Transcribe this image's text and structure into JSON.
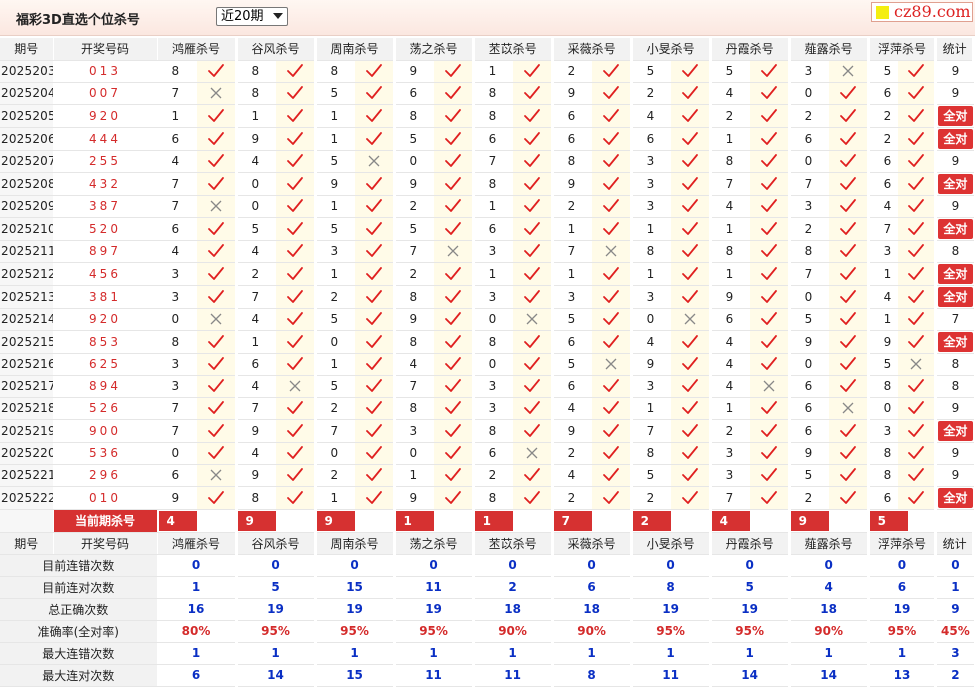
{
  "title": "福彩3D直选个位杀号",
  "period_select": {
    "selected": "近20期"
  },
  "logo": {
    "text": "cz89.com"
  },
  "colors": {
    "accent": "#d63131",
    "blue": "#0a2fc4",
    "mark_bg": "#fffbe8"
  },
  "icons": {
    "correct": "check-icon",
    "wrong": "cross-icon"
  },
  "headers": [
    "期号",
    "开奖号码",
    "鸿雁杀号",
    "谷风杀号",
    "周南杀号",
    "荡之杀号",
    "苤苡杀号",
    "采薇杀号",
    "小旻杀号",
    "丹霞杀号",
    "薤露杀号",
    "浮萍杀号",
    "统计"
  ],
  "rows": [
    {
      "period": "2025203",
      "number": "013",
      "kills": [
        [
          "8",
          "ok"
        ],
        [
          "8",
          "ok"
        ],
        [
          "8",
          "ok"
        ],
        [
          "9",
          "ok"
        ],
        [
          "1",
          "ok"
        ],
        [
          "2",
          "ok"
        ],
        [
          "5",
          "ok"
        ],
        [
          "5",
          "ok"
        ],
        [
          "3",
          "x"
        ],
        [
          "5",
          "ok"
        ]
      ],
      "stat": "9"
    },
    {
      "period": "2025204",
      "number": "007",
      "kills": [
        [
          "7",
          "x"
        ],
        [
          "8",
          "ok"
        ],
        [
          "5",
          "ok"
        ],
        [
          "6",
          "ok"
        ],
        [
          "8",
          "ok"
        ],
        [
          "9",
          "ok"
        ],
        [
          "2",
          "ok"
        ],
        [
          "4",
          "ok"
        ],
        [
          "0",
          "ok"
        ],
        [
          "6",
          "ok"
        ]
      ],
      "stat": "9"
    },
    {
      "period": "2025205",
      "number": "920",
      "kills": [
        [
          "1",
          "ok"
        ],
        [
          "1",
          "ok"
        ],
        [
          "1",
          "ok"
        ],
        [
          "8",
          "ok"
        ],
        [
          "8",
          "ok"
        ],
        [
          "6",
          "ok"
        ],
        [
          "4",
          "ok"
        ],
        [
          "2",
          "ok"
        ],
        [
          "2",
          "ok"
        ],
        [
          "2",
          "ok"
        ]
      ],
      "stat": "全对"
    },
    {
      "period": "2025206",
      "number": "444",
      "kills": [
        [
          "6",
          "ok"
        ],
        [
          "9",
          "ok"
        ],
        [
          "1",
          "ok"
        ],
        [
          "5",
          "ok"
        ],
        [
          "6",
          "ok"
        ],
        [
          "6",
          "ok"
        ],
        [
          "6",
          "ok"
        ],
        [
          "1",
          "ok"
        ],
        [
          "6",
          "ok"
        ],
        [
          "2",
          "ok"
        ]
      ],
      "stat": "全对"
    },
    {
      "period": "2025207",
      "number": "255",
      "kills": [
        [
          "4",
          "ok"
        ],
        [
          "4",
          "ok"
        ],
        [
          "5",
          "x"
        ],
        [
          "0",
          "ok"
        ],
        [
          "7",
          "ok"
        ],
        [
          "8",
          "ok"
        ],
        [
          "3",
          "ok"
        ],
        [
          "8",
          "ok"
        ],
        [
          "0",
          "ok"
        ],
        [
          "6",
          "ok"
        ]
      ],
      "stat": "9"
    },
    {
      "period": "2025208",
      "number": "432",
      "kills": [
        [
          "7",
          "ok"
        ],
        [
          "0",
          "ok"
        ],
        [
          "9",
          "ok"
        ],
        [
          "9",
          "ok"
        ],
        [
          "8",
          "ok"
        ],
        [
          "9",
          "ok"
        ],
        [
          "3",
          "ok"
        ],
        [
          "7",
          "ok"
        ],
        [
          "7",
          "ok"
        ],
        [
          "6",
          "ok"
        ]
      ],
      "stat": "全对"
    },
    {
      "period": "2025209",
      "number": "387",
      "kills": [
        [
          "7",
          "x"
        ],
        [
          "0",
          "ok"
        ],
        [
          "1",
          "ok"
        ],
        [
          "2",
          "ok"
        ],
        [
          "1",
          "ok"
        ],
        [
          "2",
          "ok"
        ],
        [
          "3",
          "ok"
        ],
        [
          "4",
          "ok"
        ],
        [
          "3",
          "ok"
        ],
        [
          "4",
          "ok"
        ]
      ],
      "stat": "9"
    },
    {
      "period": "2025210",
      "number": "520",
      "kills": [
        [
          "6",
          "ok"
        ],
        [
          "5",
          "ok"
        ],
        [
          "5",
          "ok"
        ],
        [
          "5",
          "ok"
        ],
        [
          "6",
          "ok"
        ],
        [
          "1",
          "ok"
        ],
        [
          "1",
          "ok"
        ],
        [
          "1",
          "ok"
        ],
        [
          "2",
          "ok"
        ],
        [
          "7",
          "ok"
        ]
      ],
      "stat": "全对"
    },
    {
      "period": "2025211",
      "number": "897",
      "kills": [
        [
          "4",
          "ok"
        ],
        [
          "4",
          "ok"
        ],
        [
          "3",
          "ok"
        ],
        [
          "7",
          "x"
        ],
        [
          "3",
          "ok"
        ],
        [
          "7",
          "x"
        ],
        [
          "8",
          "ok"
        ],
        [
          "8",
          "ok"
        ],
        [
          "8",
          "ok"
        ],
        [
          "3",
          "ok"
        ]
      ],
      "stat": "8"
    },
    {
      "period": "2025212",
      "number": "456",
      "kills": [
        [
          "3",
          "ok"
        ],
        [
          "2",
          "ok"
        ],
        [
          "1",
          "ok"
        ],
        [
          "2",
          "ok"
        ],
        [
          "1",
          "ok"
        ],
        [
          "1",
          "ok"
        ],
        [
          "1",
          "ok"
        ],
        [
          "1",
          "ok"
        ],
        [
          "7",
          "ok"
        ],
        [
          "1",
          "ok"
        ]
      ],
      "stat": "全对"
    },
    {
      "period": "2025213",
      "number": "381",
      "kills": [
        [
          "3",
          "ok"
        ],
        [
          "7",
          "ok"
        ],
        [
          "2",
          "ok"
        ],
        [
          "8",
          "ok"
        ],
        [
          "3",
          "ok"
        ],
        [
          "3",
          "ok"
        ],
        [
          "3",
          "ok"
        ],
        [
          "9",
          "ok"
        ],
        [
          "0",
          "ok"
        ],
        [
          "4",
          "ok"
        ]
      ],
      "stat": "全对"
    },
    {
      "period": "2025214",
      "number": "920",
      "kills": [
        [
          "0",
          "x"
        ],
        [
          "4",
          "ok"
        ],
        [
          "5",
          "ok"
        ],
        [
          "9",
          "ok"
        ],
        [
          "0",
          "x"
        ],
        [
          "5",
          "ok"
        ],
        [
          "0",
          "x"
        ],
        [
          "6",
          "ok"
        ],
        [
          "5",
          "ok"
        ],
        [
          "1",
          "ok"
        ]
      ],
      "stat": "7"
    },
    {
      "period": "2025215",
      "number": "853",
      "kills": [
        [
          "8",
          "ok"
        ],
        [
          "1",
          "ok"
        ],
        [
          "0",
          "ok"
        ],
        [
          "8",
          "ok"
        ],
        [
          "8",
          "ok"
        ],
        [
          "6",
          "ok"
        ],
        [
          "4",
          "ok"
        ],
        [
          "4",
          "ok"
        ],
        [
          "9",
          "ok"
        ],
        [
          "9",
          "ok"
        ]
      ],
      "stat": "全对"
    },
    {
      "period": "2025216",
      "number": "625",
      "kills": [
        [
          "3",
          "ok"
        ],
        [
          "6",
          "ok"
        ],
        [
          "1",
          "ok"
        ],
        [
          "4",
          "ok"
        ],
        [
          "0",
          "ok"
        ],
        [
          "5",
          "x"
        ],
        [
          "9",
          "ok"
        ],
        [
          "4",
          "ok"
        ],
        [
          "0",
          "ok"
        ],
        [
          "5",
          "x"
        ]
      ],
      "stat": "8"
    },
    {
      "period": "2025217",
      "number": "894",
      "kills": [
        [
          "3",
          "ok"
        ],
        [
          "4",
          "x"
        ],
        [
          "5",
          "ok"
        ],
        [
          "7",
          "ok"
        ],
        [
          "3",
          "ok"
        ],
        [
          "6",
          "ok"
        ],
        [
          "3",
          "ok"
        ],
        [
          "4",
          "x"
        ],
        [
          "6",
          "ok"
        ],
        [
          "8",
          "ok"
        ]
      ],
      "stat": "8"
    },
    {
      "period": "2025218",
      "number": "526",
      "kills": [
        [
          "7",
          "ok"
        ],
        [
          "7",
          "ok"
        ],
        [
          "2",
          "ok"
        ],
        [
          "8",
          "ok"
        ],
        [
          "3",
          "ok"
        ],
        [
          "4",
          "ok"
        ],
        [
          "1",
          "ok"
        ],
        [
          "1",
          "ok"
        ],
        [
          "6",
          "x"
        ],
        [
          "0",
          "ok"
        ]
      ],
      "stat": "9"
    },
    {
      "period": "2025219",
      "number": "900",
      "kills": [
        [
          "7",
          "ok"
        ],
        [
          "9",
          "ok"
        ],
        [
          "7",
          "ok"
        ],
        [
          "3",
          "ok"
        ],
        [
          "8",
          "ok"
        ],
        [
          "9",
          "ok"
        ],
        [
          "7",
          "ok"
        ],
        [
          "2",
          "ok"
        ],
        [
          "6",
          "ok"
        ],
        [
          "3",
          "ok"
        ]
      ],
      "stat": "全对"
    },
    {
      "period": "2025220",
      "number": "536",
      "kills": [
        [
          "0",
          "ok"
        ],
        [
          "4",
          "ok"
        ],
        [
          "0",
          "ok"
        ],
        [
          "0",
          "ok"
        ],
        [
          "6",
          "x"
        ],
        [
          "2",
          "ok"
        ],
        [
          "8",
          "ok"
        ],
        [
          "3",
          "ok"
        ],
        [
          "9",
          "ok"
        ],
        [
          "8",
          "ok"
        ]
      ],
      "stat": "9"
    },
    {
      "period": "2025221",
      "number": "296",
      "kills": [
        [
          "6",
          "x"
        ],
        [
          "9",
          "ok"
        ],
        [
          "2",
          "ok"
        ],
        [
          "1",
          "ok"
        ],
        [
          "2",
          "ok"
        ],
        [
          "4",
          "ok"
        ],
        [
          "5",
          "ok"
        ],
        [
          "3",
          "ok"
        ],
        [
          "5",
          "ok"
        ],
        [
          "8",
          "ok"
        ]
      ],
      "stat": "9"
    },
    {
      "period": "2025222",
      "number": "010",
      "kills": [
        [
          "9",
          "ok"
        ],
        [
          "8",
          "ok"
        ],
        [
          "1",
          "ok"
        ],
        [
          "9",
          "ok"
        ],
        [
          "8",
          "ok"
        ],
        [
          "2",
          "ok"
        ],
        [
          "2",
          "ok"
        ],
        [
          "7",
          "ok"
        ],
        [
          "2",
          "ok"
        ],
        [
          "6",
          "ok"
        ]
      ],
      "stat": "全对"
    }
  ],
  "current": {
    "label": "当前期杀号",
    "values": [
      "4",
      "9",
      "9",
      "1",
      "1",
      "7",
      "2",
      "4",
      "9",
      "5"
    ]
  },
  "summary": [
    {
      "label": "目前连错次数",
      "values": [
        "0",
        "0",
        "0",
        "0",
        "0",
        "0",
        "0",
        "0",
        "0",
        "0",
        "0"
      ],
      "color": "blue"
    },
    {
      "label": "目前连对次数",
      "values": [
        "1",
        "5",
        "15",
        "11",
        "2",
        "6",
        "8",
        "5",
        "4",
        "6",
        "1"
      ],
      "color": "blue"
    },
    {
      "label": "总正确次数",
      "values": [
        "16",
        "19",
        "19",
        "19",
        "18",
        "18",
        "19",
        "19",
        "18",
        "19",
        "9"
      ],
      "color": "blue"
    },
    {
      "label": "准确率(全对率)",
      "values": [
        "80%",
        "95%",
        "95%",
        "95%",
        "90%",
        "90%",
        "95%",
        "95%",
        "90%",
        "95%",
        "45%"
      ],
      "color": "red"
    },
    {
      "label": "最大连错次数",
      "values": [
        "1",
        "1",
        "1",
        "1",
        "1",
        "1",
        "1",
        "1",
        "1",
        "1",
        "3"
      ],
      "color": "blue"
    },
    {
      "label": "最大连对次数",
      "values": [
        "6",
        "14",
        "15",
        "11",
        "11",
        "8",
        "11",
        "14",
        "14",
        "13",
        "2"
      ],
      "color": "blue"
    }
  ]
}
